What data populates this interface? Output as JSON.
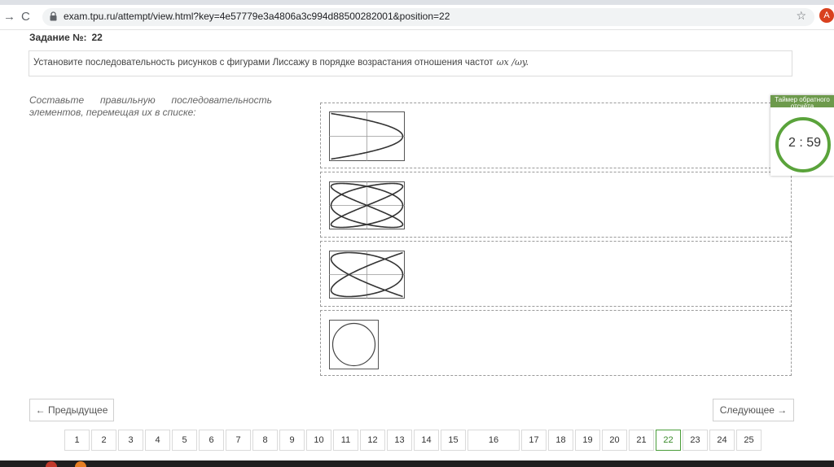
{
  "browser": {
    "url": "exam.tpu.ru/attempt/view.html?key=4e57779e3a4806a3c994d88500282001&position=22",
    "back_icon": "arrow-left-icon",
    "reload_icon": "reload-icon",
    "avatar_letter": "A"
  },
  "task": {
    "label": "Задание №:",
    "number": "22",
    "question": "Установите последовательность рисунков с фигурами Лиссажу в порядке возрастания отношения частот",
    "formula": "ωx /ωy.",
    "instruction": "Составьте правильную последовательность элементов, перемещая их в списке:"
  },
  "items": [
    {
      "figure": "lissajous-1-2"
    },
    {
      "figure": "lissajous-2-3"
    },
    {
      "figure": "lissajous-3-4"
    },
    {
      "figure": "circle"
    }
  ],
  "timer": {
    "title": "Таймер обратного отсчёта",
    "value": "2 : 59",
    "color": "#5aa33b",
    "header_color": "#6d9a4c"
  },
  "nav": {
    "prev": "← Предыдущее",
    "next": "Следующее →"
  },
  "pages": [
    "1",
    "2",
    "3",
    "4",
    "5",
    "6",
    "7",
    "8",
    "9",
    "10",
    "11",
    "12",
    "13",
    "14",
    "15",
    "16",
    "17",
    "18",
    "19",
    "20",
    "21",
    "22",
    "23",
    "24",
    "25"
  ],
  "current_page": "22",
  "accent_color": "#4a9e3a"
}
